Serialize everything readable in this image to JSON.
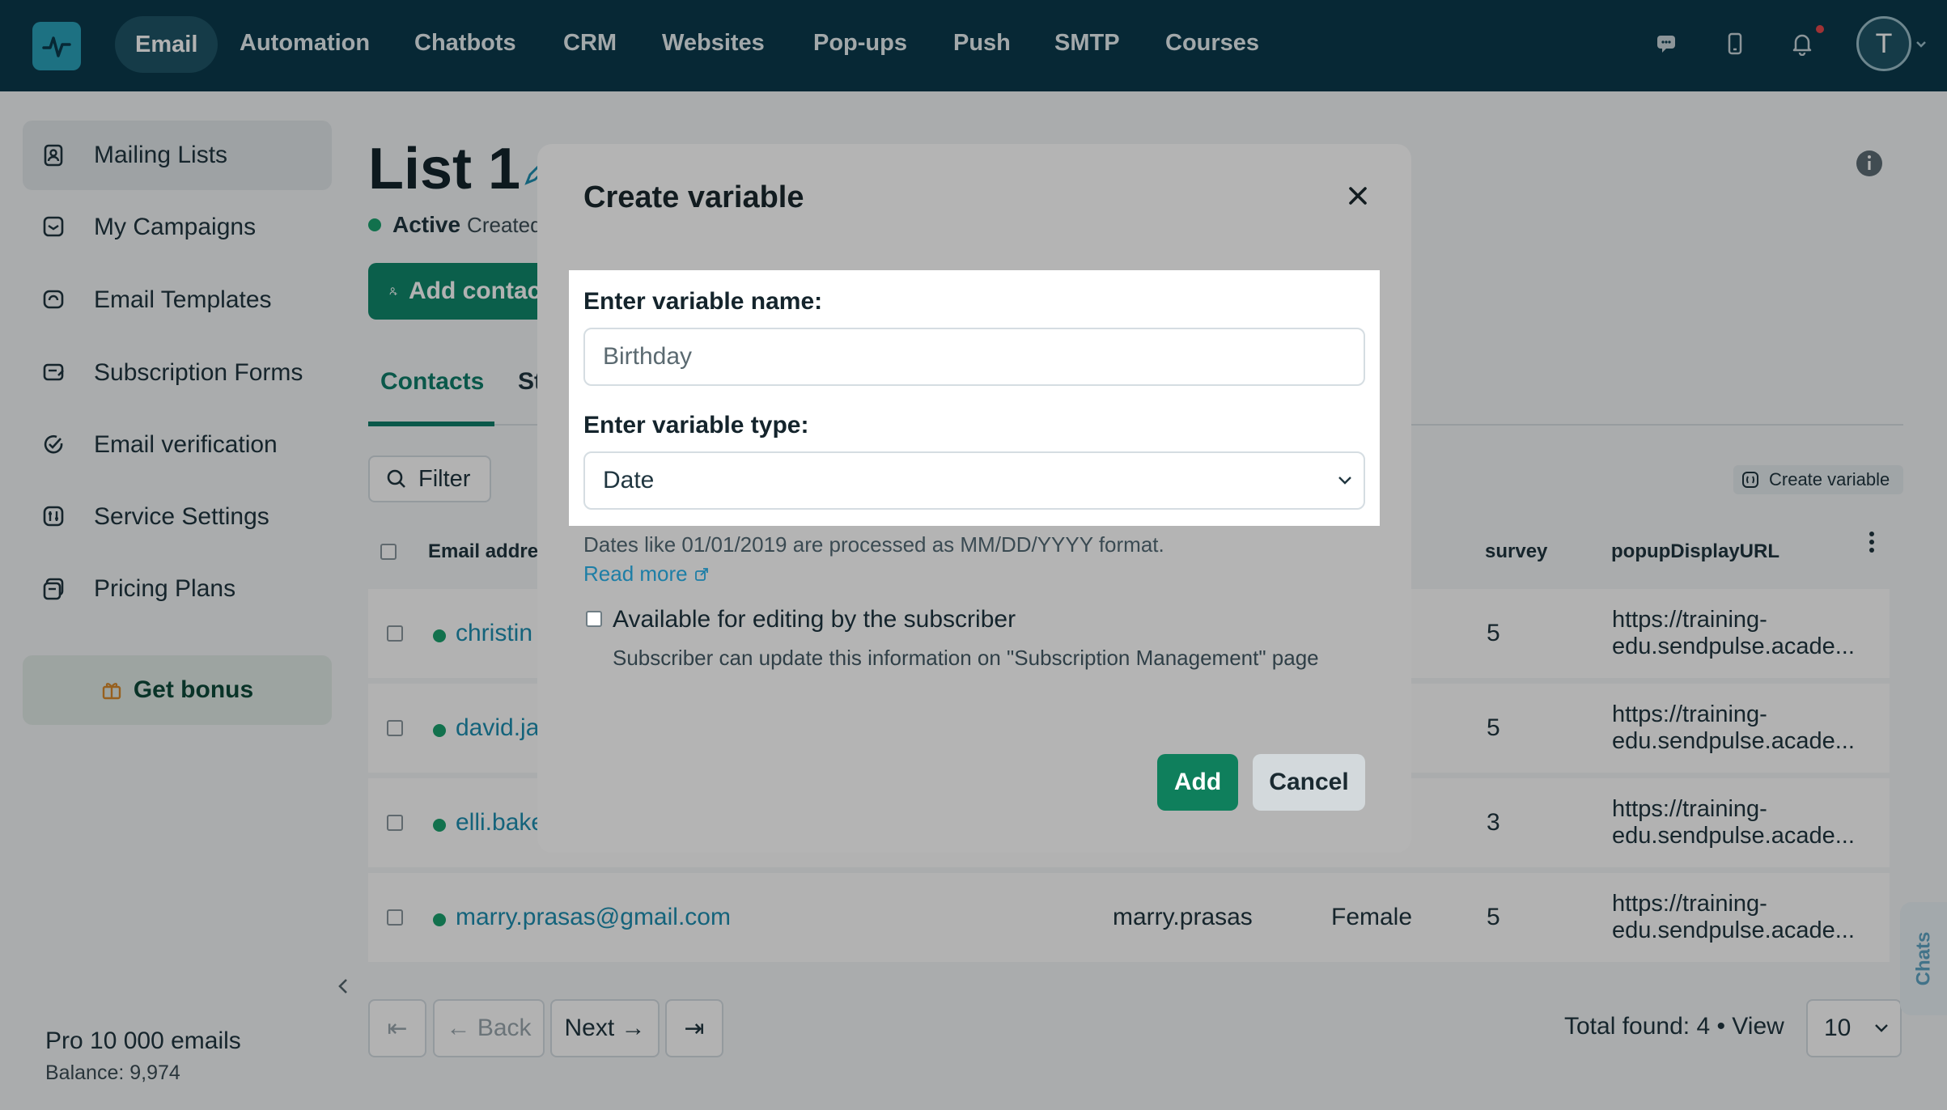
{
  "nav": {
    "items": [
      {
        "label": "Email",
        "active": true
      },
      {
        "label": "Automation"
      },
      {
        "label": "Chatbots"
      },
      {
        "label": "CRM"
      },
      {
        "label": "Websites"
      },
      {
        "label": "Pop-ups"
      },
      {
        "label": "Push"
      },
      {
        "label": "SMTP"
      },
      {
        "label": "Courses"
      }
    ],
    "icons": [
      "chat-icon",
      "mobile-icon",
      "bell-icon"
    ],
    "avatar_initial": "T"
  },
  "sidebar": {
    "items": [
      {
        "label": "Mailing Lists",
        "icon": "contacts-book-icon",
        "active": true
      },
      {
        "label": "My Campaigns",
        "icon": "campaign-icon"
      },
      {
        "label": "Email Templates",
        "icon": "template-icon"
      },
      {
        "label": "Subscription Forms",
        "icon": "form-icon"
      },
      {
        "label": "Email verification",
        "icon": "verify-icon"
      },
      {
        "label": "Service Settings",
        "icon": "settings-icon"
      },
      {
        "label": "Pricing Plans",
        "icon": "pricing-icon"
      }
    ],
    "bonus_label": "Get bonus",
    "plan": "Pro 10 000 emails",
    "balance": "Balance: 9,974"
  },
  "main": {
    "title": "List 1",
    "status": "Active",
    "created": "Created",
    "add_contacts": "Add contacts",
    "tabs": [
      "Contacts",
      "St"
    ],
    "filter": "Filter",
    "create_variable": "Create variable",
    "columns": {
      "email": "Email addres",
      "survey": "survey",
      "popup": "popupDisplayURL"
    },
    "rows": [
      {
        "email": "christin",
        "name": "",
        "gender": "",
        "survey": "5",
        "url1": "https://training-",
        "url2": "edu.sendpulse.acade..."
      },
      {
        "email": "david.ja",
        "name": "",
        "gender": "",
        "survey": "5",
        "url1": "https://training-",
        "url2": "edu.sendpulse.acade..."
      },
      {
        "email": "elli.bake",
        "name": "",
        "gender": "",
        "survey": "3",
        "url1": "https://training-",
        "url2": "edu.sendpulse.acade..."
      },
      {
        "email": "marry.prasas@gmail.com",
        "name": "marry.prasas",
        "gender": "Female",
        "survey": "5",
        "url1": "https://training-",
        "url2": "edu.sendpulse.acade..."
      }
    ],
    "pager": {
      "back": "← Back",
      "next": "Next →",
      "first": "⇤",
      "last": "⇥"
    },
    "total": "Total found: 4  •  View",
    "view_value": "10",
    "chats": "Chats"
  },
  "modal": {
    "title": "Create variable",
    "name_label": "Enter variable name:",
    "name_value": "Birthday",
    "type_label": "Enter variable type:",
    "type_value": "Date",
    "hint": "Dates like 01/01/2019 are processed as MM/DD/YYYY format.",
    "read_more": "Read more",
    "checkbox_label": "Available for editing by the subscriber",
    "checkbox_sub": "Subscriber can update this information on \"Subscription Management\" page",
    "add": "Add",
    "cancel": "Cancel"
  }
}
